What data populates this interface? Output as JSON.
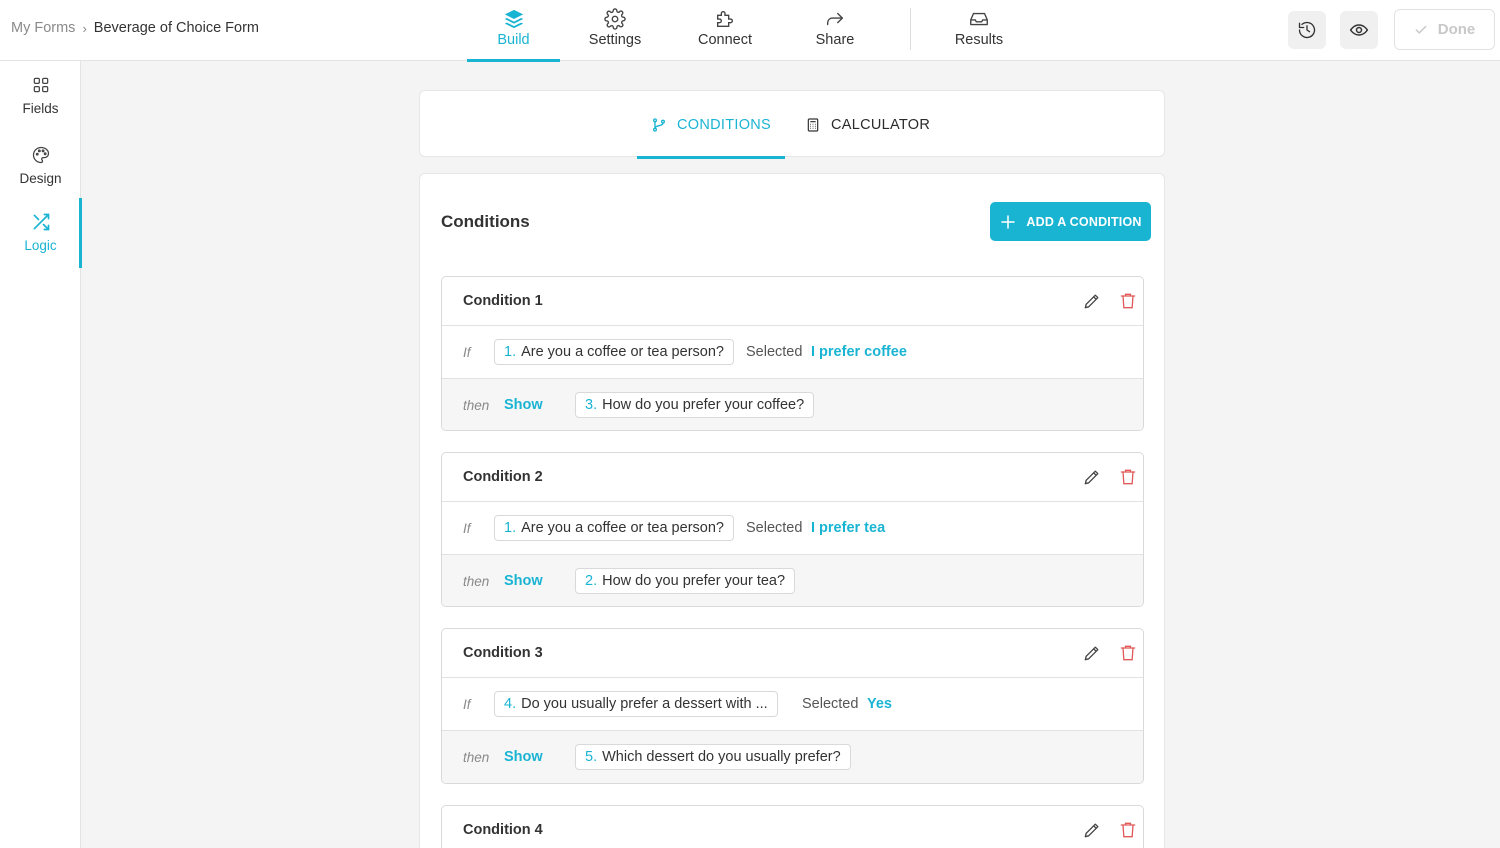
{
  "breadcrumb": {
    "parent": "My Forms",
    "separator": "›",
    "current": "Beverage of Choice Form"
  },
  "top_tabs": [
    {
      "label": "Build",
      "icon": "layers-icon",
      "active": true
    },
    {
      "label": "Settings",
      "icon": "gear-icon",
      "active": false
    },
    {
      "label": "Connect",
      "icon": "puzzle-icon",
      "active": false
    },
    {
      "label": "Share",
      "icon": "share-arrow-icon",
      "active": false
    },
    {
      "label": "Results",
      "icon": "inbox-icon",
      "active": false
    }
  ],
  "top_actions": {
    "history_icon": "history-icon",
    "preview_icon": "eye-icon",
    "done_label": "Done"
  },
  "sidebar": {
    "items": [
      {
        "label": "Fields",
        "icon": "grid-icon",
        "active": false
      },
      {
        "label": "Design",
        "icon": "palette-icon",
        "active": false
      },
      {
        "label": "Logic",
        "icon": "shuffle-icon",
        "active": true
      }
    ]
  },
  "sub_tabs": [
    {
      "label": "CONDITIONS",
      "icon": "branch-icon",
      "active": true
    },
    {
      "label": "CALCULATOR",
      "icon": "calculator-icon",
      "active": false
    }
  ],
  "panel": {
    "title": "Conditions",
    "add_button_label": "ADD A CONDITION",
    "if_label": "If",
    "then_label": "then",
    "selected_label": "Selected",
    "conditions": [
      {
        "title": "Condition 1",
        "if_num": "1.",
        "if_question": "Are you a coffee or tea person?",
        "value": "I prefer coffee",
        "action": "Show",
        "then_num": "3.",
        "then_question": "How do you prefer your coffee?"
      },
      {
        "title": "Condition 2",
        "if_num": "1.",
        "if_question": "Are you a coffee or tea person?",
        "value": "I prefer tea",
        "action": "Show",
        "then_num": "2.",
        "then_question": "How do you prefer your tea?"
      },
      {
        "title": "Condition 3",
        "if_num": "4.",
        "if_question": "Do you usually prefer a dessert with ...",
        "value": "Yes",
        "action": "Show",
        "then_num": "5.",
        "then_question": "Which dessert do you usually prefer?"
      },
      {
        "title": "Condition 4"
      }
    ]
  },
  "colors": {
    "accent": "#1ab4d3",
    "delete": "#e05a5a"
  }
}
